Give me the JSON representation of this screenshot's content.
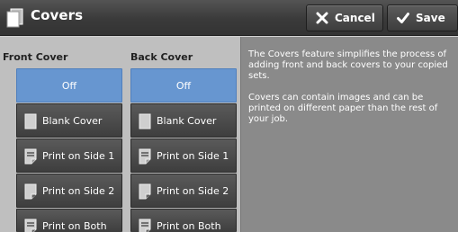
{
  "header": {
    "title": "Covers",
    "title_icon": "covers-icon",
    "cancel_label": "Cancel",
    "save_label": "Save"
  },
  "front_cover": {
    "label": "Front Cover",
    "options": [
      {
        "label": "Off",
        "selected": true
      },
      {
        "label": "Blank Cover",
        "icon": "blank-cover-icon"
      },
      {
        "label": "Print on Side 1",
        "icon": "print-side1-icon"
      },
      {
        "label": "Print on Side 2",
        "icon": "print-side2-icon"
      },
      {
        "label": "Print on Both",
        "icon": "print-both-icon"
      }
    ]
  },
  "back_cover": {
    "label": "Back Cover",
    "options": [
      {
        "label": "Off",
        "selected": true
      },
      {
        "label": "Blank Cover",
        "icon": "blank-cover-icon"
      },
      {
        "label": "Print on Side 1",
        "icon": "print-side1-icon"
      },
      {
        "label": "Print on Side 2",
        "icon": "print-side2-icon"
      },
      {
        "label": "Print on Both",
        "icon": "print-both-icon"
      }
    ]
  },
  "info": {
    "paragraph1": "The Covers feature simplifies the process of adding front and back covers to your copied sets.",
    "paragraph2": "Covers can contain images and can be printed on different paper than the rest of your job."
  },
  "colors": {
    "selected": "#6796d0",
    "button": "#4a4a4a",
    "panel": "#8a8a8a"
  }
}
